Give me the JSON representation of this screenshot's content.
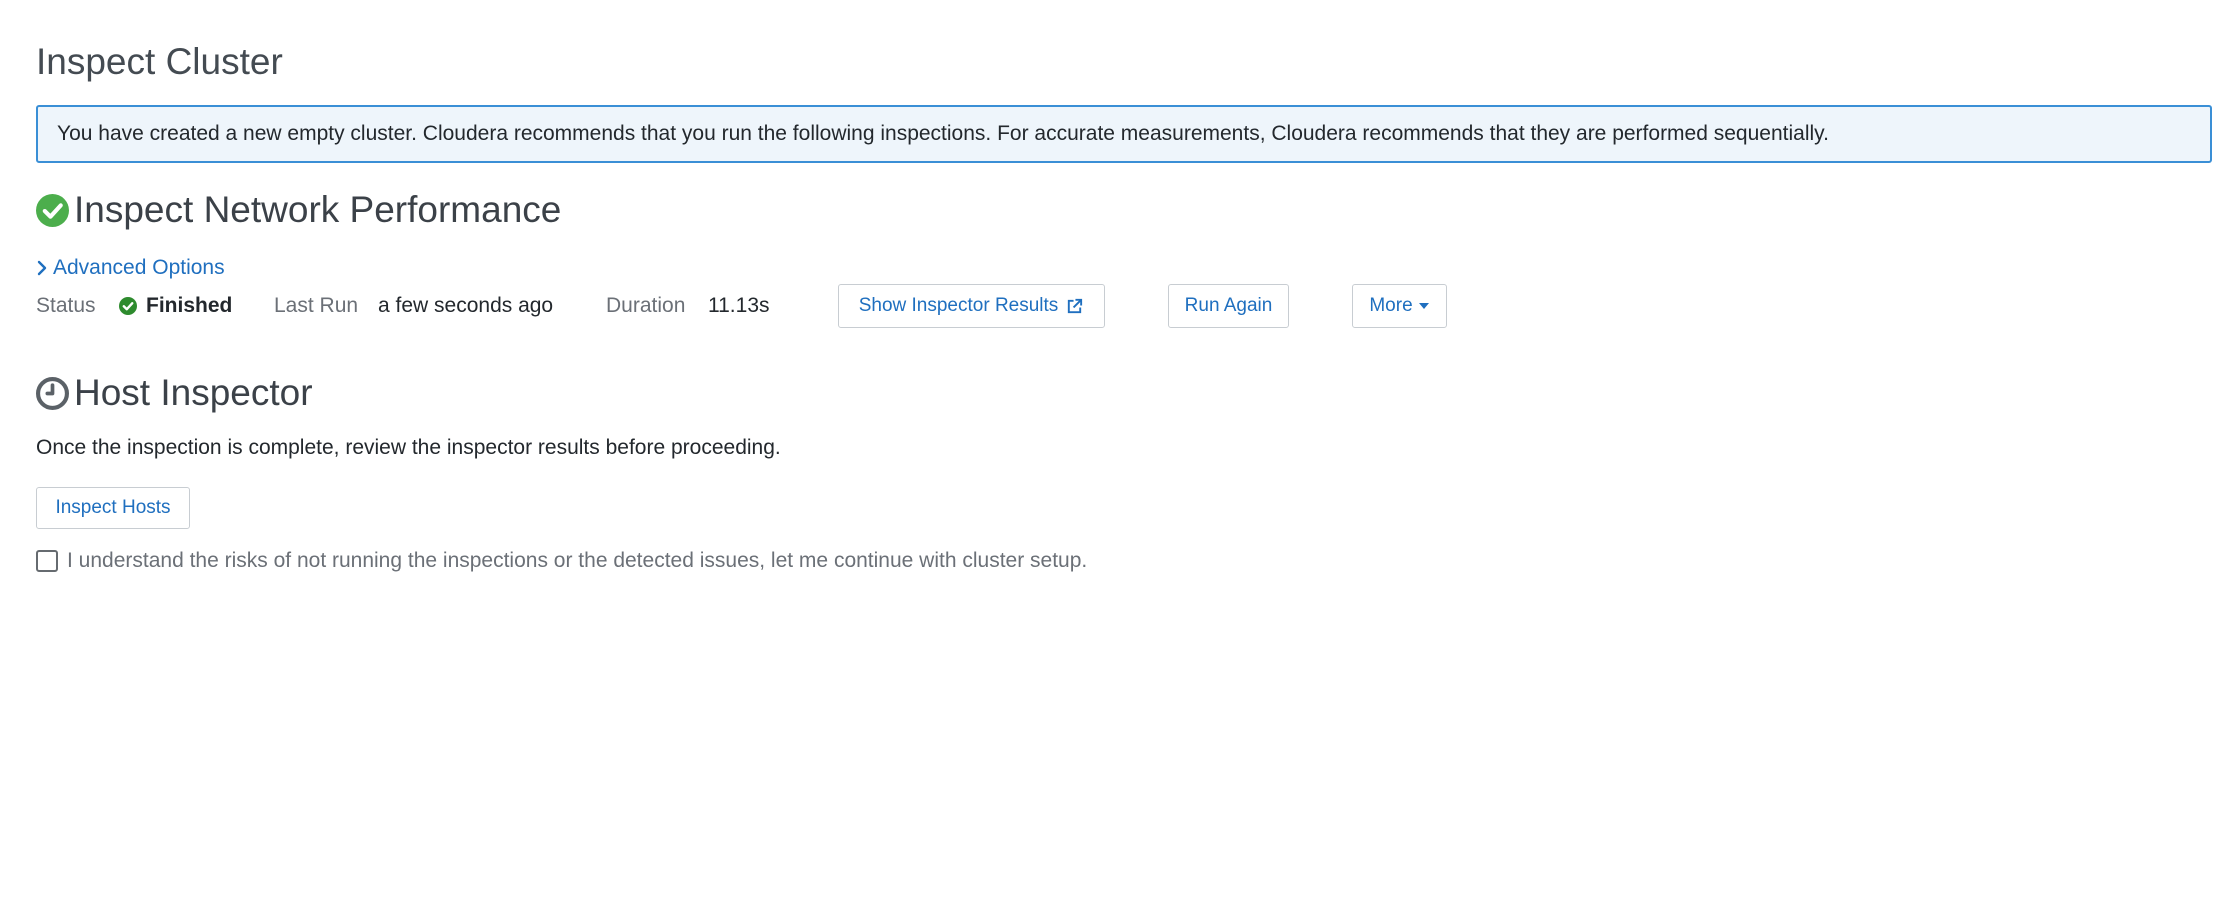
{
  "page": {
    "title": "Inspect Cluster"
  },
  "info": {
    "message": "You have created a new empty cluster. Cloudera recommends that you run the following inspections. For accurate measurements, Cloudera recommends that they are performed sequentially."
  },
  "network": {
    "title": "Inspect Network Performance",
    "icon": "check-circle-icon",
    "advanced_options": "Advanced Options",
    "status_label": "Status",
    "status_value": "Finished",
    "last_run_label": "Last Run",
    "last_run_value": "a few seconds ago",
    "duration_label": "Duration",
    "duration_value": "11.13s",
    "show_results_button": "Show Inspector Results",
    "run_again_button": "Run Again",
    "more_button": "More"
  },
  "host": {
    "title": "Host Inspector",
    "icon": "clock-icon",
    "description": "Once the inspection is complete, review the inspector results before proceeding.",
    "inspect_button": "Inspect Hosts",
    "risk_checkbox_label": "I understand the risks of not running the inspections or the detected issues, let me continue with cluster setup.",
    "risk_checked": false
  },
  "colors": {
    "success": "#4cae4c",
    "link": "#1f6fbf",
    "info_border": "#3a8fd6",
    "info_bg": "#eef5fb"
  }
}
